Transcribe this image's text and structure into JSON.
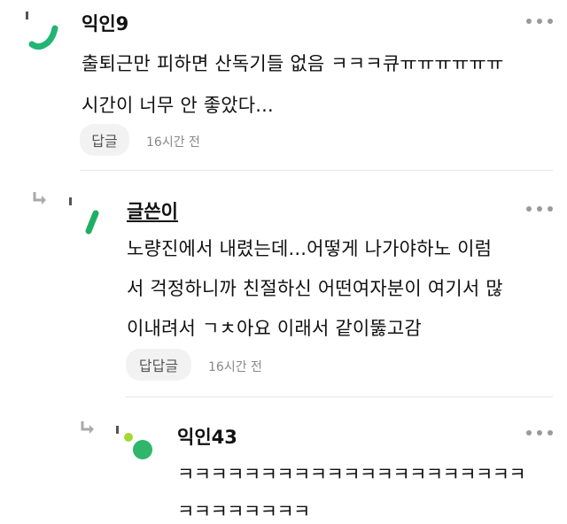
{
  "comments": [
    {
      "author": "익인9",
      "lines": [
        "출퇴근만 피하면 산독기들 없음 ㅋㅋㅋ큐ㅠㅠㅠㅠㅠㅠ",
        "시간이 너무 안 좋았다..."
      ],
      "reply_label": "답글",
      "time": "16시간 전",
      "avatar_colors": [
        "#22b573"
      ]
    },
    {
      "author": "글쓴이",
      "lines": [
        "노량진에서 내렸는데...어떻게 나가야하노 이럼",
        "서 걱정하니까 친절하신 어떤여자분이 여기서 많",
        "이내려서 ㄱㅊ아요 이래서 같이뚫고감"
      ],
      "reply_label": "답답글",
      "time": "16시간 전",
      "avatar_colors": [
        "#1fae62"
      ]
    },
    {
      "author": "익인43",
      "lines": [
        "ㅋㅋㅋㅋㅋㅋㅋㅋㅋㅋㅋㅋㅋㅋㅋㅋㅋㅋㅋㅋㅋ",
        "ㅋㅋㅋㅋㅋㅋㅋㅋ"
      ],
      "avatar_colors": [
        "#a3d932",
        "#2fb66a"
      ]
    }
  ]
}
